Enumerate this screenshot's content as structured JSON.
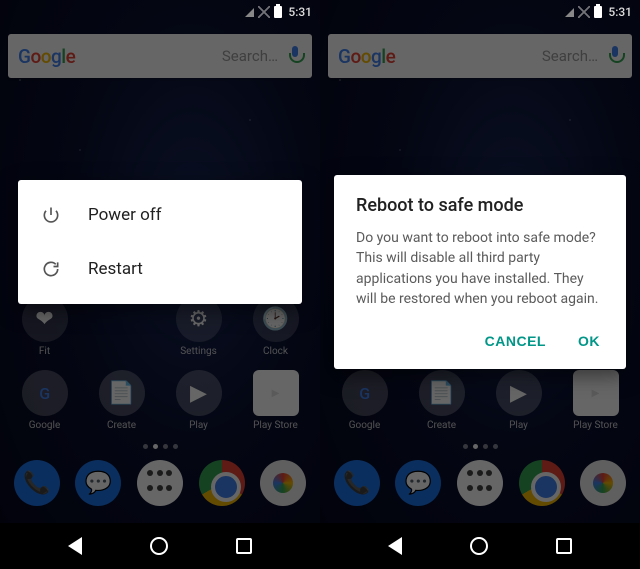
{
  "status": {
    "time": "5:31"
  },
  "search": {
    "placeholder": "Search…"
  },
  "power_menu": {
    "power_off": "Power off",
    "restart": "Restart"
  },
  "dialog": {
    "title": "Reboot to safe mode",
    "body": "Do you want to reboot into safe mode? This will disable all third party applications you have installed. They will be restored when you reboot again.",
    "cancel": "CANCEL",
    "ok": "OK"
  },
  "apps": {
    "row1": [
      "Fit",
      "",
      "Settings",
      "Clock"
    ],
    "row2": [
      "Google",
      "Create",
      "Play",
      "Play Store"
    ]
  }
}
